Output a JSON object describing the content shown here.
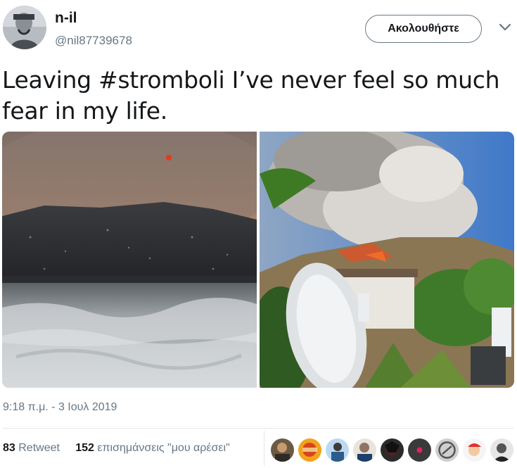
{
  "author": {
    "name": "n-il",
    "handle": "@nil87739678",
    "avatar_icon": "avatar-man-photo"
  },
  "follow_button": {
    "label": "Ακολουθήστε"
  },
  "tweet": {
    "text_line1": "Leaving #stromboli I’ve never feel so much",
    "text_line2": "fear in my life.",
    "hashtag": "#stromboli"
  },
  "media": {
    "left_photo": "volcano-smoke-sea-photo",
    "right_photo": "volcano-eruption-village-photo"
  },
  "timestamp": "9:18 π.μ. - 3 Ιουλ 2019",
  "stats": {
    "retweets_count": "83",
    "retweets_label": "Retweet",
    "likes_count": "152",
    "likes_label": "επισημάνσεις \"μου αρέσει\""
  },
  "likers": [
    "liker-1",
    "liker-2",
    "liker-3",
    "liker-4",
    "liker-5",
    "liker-6",
    "liker-7",
    "liker-8",
    "liker-9"
  ],
  "colors": {
    "text": "#14171a",
    "secondary": "#657786",
    "border": "#e1e8ed"
  }
}
